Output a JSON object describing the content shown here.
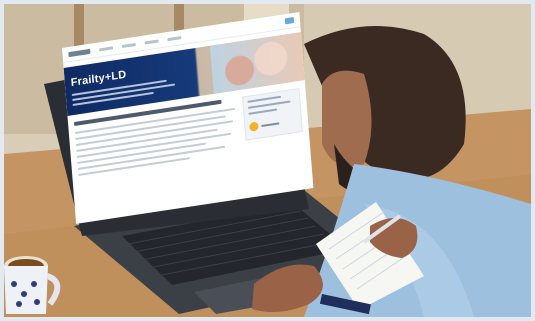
{
  "website": {
    "hero_title": "Frailty+LD"
  },
  "colors": {
    "hero_navy": "#163a7a",
    "frame": "#e3e9f1",
    "accent_yellow": "#f1b12a"
  },
  "icons": {
    "site_badge": "accessibility-badge-icon",
    "card_dot": "circle-icon"
  }
}
